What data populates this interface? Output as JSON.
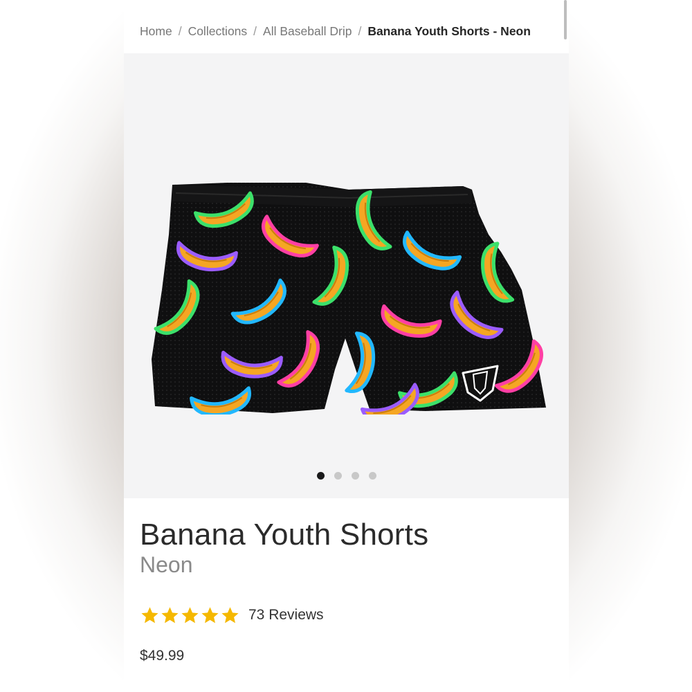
{
  "breadcrumb": {
    "items": [
      "Home",
      "Collections",
      "All Baseball Drip"
    ],
    "separator": "/",
    "current": "Banana Youth Shorts - Neon"
  },
  "gallery": {
    "image_icon": "banana-print-shorts-image",
    "slide_count": 4,
    "active_slide": 1
  },
  "product": {
    "title": "Banana Youth Shorts",
    "variant": "Neon",
    "rating": 5,
    "rating_max": 5,
    "reviews_label": "73 Reviews",
    "price": "$49.99"
  },
  "colors": {
    "star": "#f5b800",
    "dot_active": "#1a1a1a",
    "dot_inactive": "#c8c8c8",
    "gallery_bg": "#f4f4f5"
  }
}
